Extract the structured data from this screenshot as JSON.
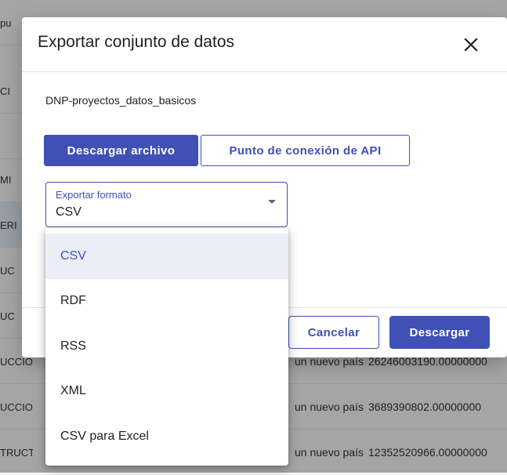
{
  "background": {
    "rows": [
      {
        "c1": "pu",
        "c2": "",
        "c3": ""
      },
      {
        "c1": "CI",
        "c2": "",
        "c3": ""
      },
      {
        "c1": "",
        "c2": "",
        "c3": ""
      },
      {
        "c1": "MI",
        "c2": "",
        "c3": ""
      },
      {
        "c1": "ERI",
        "c2": "",
        "c3": "",
        "selected": true
      },
      {
        "c1": "UC",
        "c2": "",
        "c3": ""
      },
      {
        "c1": "UC",
        "c2": "",
        "c3": ""
      },
      {
        "c1": "UCCIO",
        "c2": "un nuevo país",
        "c3": "26246003190.00000000"
      },
      {
        "c1": "UCCIO",
        "c2": "un nuevo país",
        "c3": "3689390802.00000000"
      },
      {
        "c1": "TRUCT",
        "c2": "un nuevo país",
        "c3": "12352520966.00000000"
      }
    ]
  },
  "modal": {
    "title": "Exportar conjunto de datos",
    "close_icon": "close-icon",
    "dataset_name": "DNP-proyectos_datos_basicos",
    "tabs": [
      {
        "label": "Descargar archivo",
        "active": true
      },
      {
        "label": "Punto de conexión de API",
        "active": false
      }
    ],
    "format_select": {
      "label": "Exportar formato",
      "value": "CSV",
      "caret_icon": "caret-down-icon"
    },
    "buttons": {
      "cancel": "Cancelar",
      "download": "Descargar"
    }
  },
  "dropdown": {
    "options": [
      {
        "label": "CSV",
        "selected": true
      },
      {
        "label": "RDF",
        "selected": false
      },
      {
        "label": "RSS",
        "selected": false
      },
      {
        "label": "XML",
        "selected": false
      },
      {
        "label": "CSV para Excel",
        "selected": false
      }
    ]
  },
  "colors": {
    "accent": "#3f51b5",
    "selected_bg": "#eceef7"
  }
}
